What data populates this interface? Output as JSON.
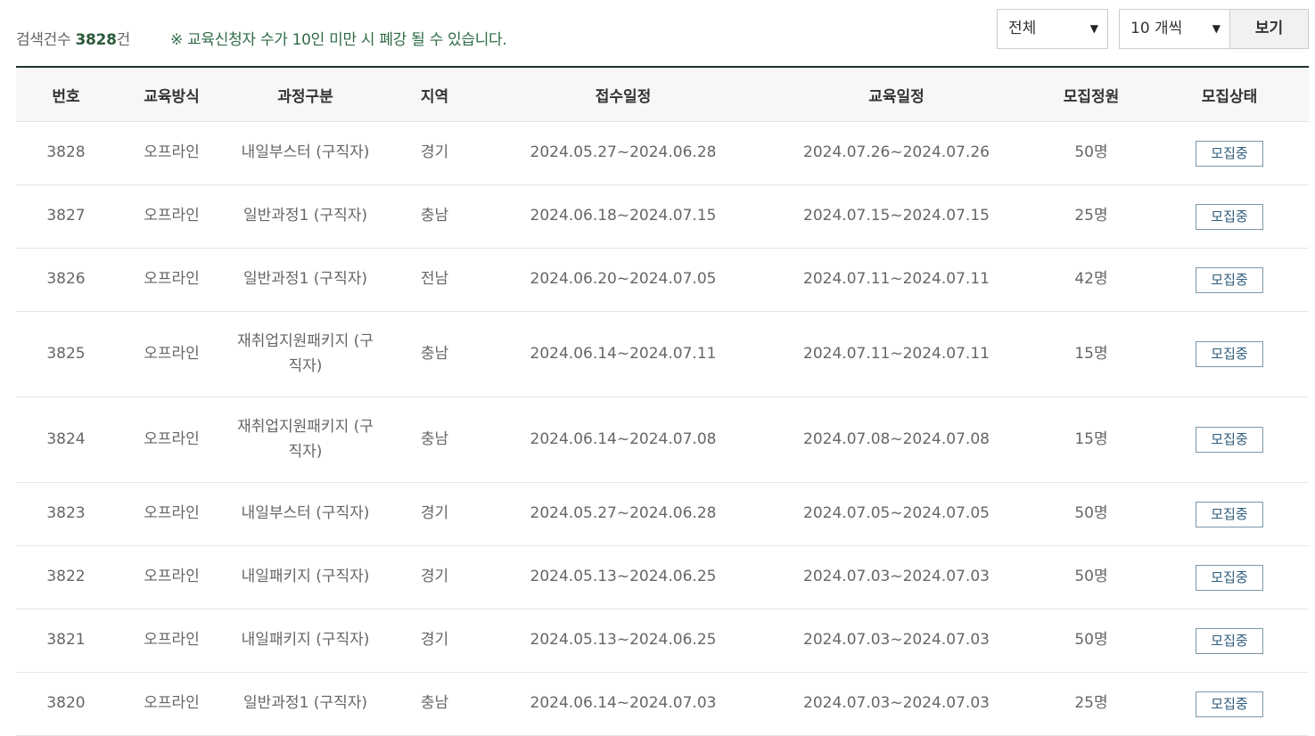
{
  "summary": {
    "count_label": "검색건수",
    "count_value": "3828",
    "count_suffix": "건",
    "notice": "※ 교육신청자 수가 10인 미만 시 폐강 될 수 있습니다."
  },
  "controls": {
    "region_select": "전체",
    "per_page_select": "10 개씩",
    "view_button": "보기"
  },
  "table": {
    "headers": [
      "번호",
      "교육방식",
      "과정구분",
      "지역",
      "접수일정",
      "교육일정",
      "모집정원",
      "모집상태"
    ],
    "rows": [
      {
        "no": "3828",
        "method": "오프라인",
        "course": "내일부스터 (구직자)",
        "region": "경기",
        "apply": "2024.05.27~2024.06.28",
        "edu": "2024.07.26~2024.07.26",
        "capacity": "50명",
        "status": "모집중"
      },
      {
        "no": "3827",
        "method": "오프라인",
        "course": "일반과정1 (구직자)",
        "region": "충남",
        "apply": "2024.06.18~2024.07.15",
        "edu": "2024.07.15~2024.07.15",
        "capacity": "25명",
        "status": "모집중"
      },
      {
        "no": "3826",
        "method": "오프라인",
        "course": "일반과정1 (구직자)",
        "region": "전남",
        "apply": "2024.06.20~2024.07.05",
        "edu": "2024.07.11~2024.07.11",
        "capacity": "42명",
        "status": "모집중"
      },
      {
        "no": "3825",
        "method": "오프라인",
        "course": "재취업지원패키지 (구직자)",
        "region": "충남",
        "apply": "2024.06.14~2024.07.11",
        "edu": "2024.07.11~2024.07.11",
        "capacity": "15명",
        "status": "모집중"
      },
      {
        "no": "3824",
        "method": "오프라인",
        "course": "재취업지원패키지 (구직자)",
        "region": "충남",
        "apply": "2024.06.14~2024.07.08",
        "edu": "2024.07.08~2024.07.08",
        "capacity": "15명",
        "status": "모집중"
      },
      {
        "no": "3823",
        "method": "오프라인",
        "course": "내일부스터 (구직자)",
        "region": "경기",
        "apply": "2024.05.27~2024.06.28",
        "edu": "2024.07.05~2024.07.05",
        "capacity": "50명",
        "status": "모집중"
      },
      {
        "no": "3822",
        "method": "오프라인",
        "course": "내일패키지 (구직자)",
        "region": "경기",
        "apply": "2024.05.13~2024.06.25",
        "edu": "2024.07.03~2024.07.03",
        "capacity": "50명",
        "status": "모집중"
      },
      {
        "no": "3821",
        "method": "오프라인",
        "course": "내일패키지 (구직자)",
        "region": "경기",
        "apply": "2024.05.13~2024.06.25",
        "edu": "2024.07.03~2024.07.03",
        "capacity": "50명",
        "status": "모집중"
      },
      {
        "no": "3820",
        "method": "오프라인",
        "course": "일반과정1 (구직자)",
        "region": "충남",
        "apply": "2024.06.14~2024.07.03",
        "edu": "2024.07.03~2024.07.03",
        "capacity": "25명",
        "status": "모집중"
      }
    ]
  },
  "icons": {
    "select_chevron": "chevron-down-icon"
  }
}
